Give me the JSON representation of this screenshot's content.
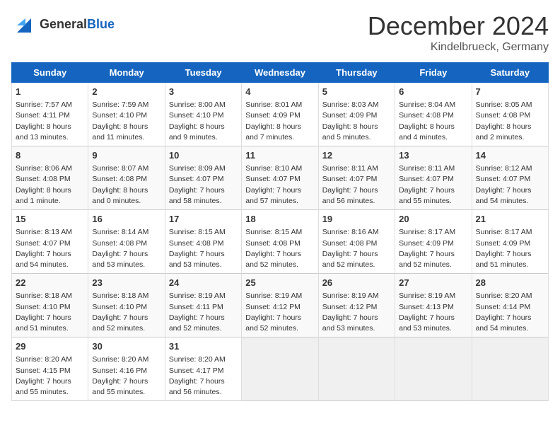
{
  "header": {
    "logo_general": "General",
    "logo_blue": "Blue",
    "title": "December 2024",
    "location": "Kindelbrueck, Germany"
  },
  "days_of_week": [
    "Sunday",
    "Monday",
    "Tuesday",
    "Wednesday",
    "Thursday",
    "Friday",
    "Saturday"
  ],
  "weeks": [
    [
      {
        "day": 1,
        "lines": [
          "Sunrise: 7:57 AM",
          "Sunset: 4:11 PM",
          "Daylight: 8 hours",
          "and 13 minutes."
        ]
      },
      {
        "day": 2,
        "lines": [
          "Sunrise: 7:59 AM",
          "Sunset: 4:10 PM",
          "Daylight: 8 hours",
          "and 11 minutes."
        ]
      },
      {
        "day": 3,
        "lines": [
          "Sunrise: 8:00 AM",
          "Sunset: 4:10 PM",
          "Daylight: 8 hours",
          "and 9 minutes."
        ]
      },
      {
        "day": 4,
        "lines": [
          "Sunrise: 8:01 AM",
          "Sunset: 4:09 PM",
          "Daylight: 8 hours",
          "and 7 minutes."
        ]
      },
      {
        "day": 5,
        "lines": [
          "Sunrise: 8:03 AM",
          "Sunset: 4:09 PM",
          "Daylight: 8 hours",
          "and 5 minutes."
        ]
      },
      {
        "day": 6,
        "lines": [
          "Sunrise: 8:04 AM",
          "Sunset: 4:08 PM",
          "Daylight: 8 hours",
          "and 4 minutes."
        ]
      },
      {
        "day": 7,
        "lines": [
          "Sunrise: 8:05 AM",
          "Sunset: 4:08 PM",
          "Daylight: 8 hours",
          "and 2 minutes."
        ]
      }
    ],
    [
      {
        "day": 8,
        "lines": [
          "Sunrise: 8:06 AM",
          "Sunset: 4:08 PM",
          "Daylight: 8 hours",
          "and 1 minute."
        ]
      },
      {
        "day": 9,
        "lines": [
          "Sunrise: 8:07 AM",
          "Sunset: 4:08 PM",
          "Daylight: 8 hours",
          "and 0 minutes."
        ]
      },
      {
        "day": 10,
        "lines": [
          "Sunrise: 8:09 AM",
          "Sunset: 4:07 PM",
          "Daylight: 7 hours",
          "and 58 minutes."
        ]
      },
      {
        "day": 11,
        "lines": [
          "Sunrise: 8:10 AM",
          "Sunset: 4:07 PM",
          "Daylight: 7 hours",
          "and 57 minutes."
        ]
      },
      {
        "day": 12,
        "lines": [
          "Sunrise: 8:11 AM",
          "Sunset: 4:07 PM",
          "Daylight: 7 hours",
          "and 56 minutes."
        ]
      },
      {
        "day": 13,
        "lines": [
          "Sunrise: 8:11 AM",
          "Sunset: 4:07 PM",
          "Daylight: 7 hours",
          "and 55 minutes."
        ]
      },
      {
        "day": 14,
        "lines": [
          "Sunrise: 8:12 AM",
          "Sunset: 4:07 PM",
          "Daylight: 7 hours",
          "and 54 minutes."
        ]
      }
    ],
    [
      {
        "day": 15,
        "lines": [
          "Sunrise: 8:13 AM",
          "Sunset: 4:07 PM",
          "Daylight: 7 hours",
          "and 54 minutes."
        ]
      },
      {
        "day": 16,
        "lines": [
          "Sunrise: 8:14 AM",
          "Sunset: 4:08 PM",
          "Daylight: 7 hours",
          "and 53 minutes."
        ]
      },
      {
        "day": 17,
        "lines": [
          "Sunrise: 8:15 AM",
          "Sunset: 4:08 PM",
          "Daylight: 7 hours",
          "and 53 minutes."
        ]
      },
      {
        "day": 18,
        "lines": [
          "Sunrise: 8:15 AM",
          "Sunset: 4:08 PM",
          "Daylight: 7 hours",
          "and 52 minutes."
        ]
      },
      {
        "day": 19,
        "lines": [
          "Sunrise: 8:16 AM",
          "Sunset: 4:08 PM",
          "Daylight: 7 hours",
          "and 52 minutes."
        ]
      },
      {
        "day": 20,
        "lines": [
          "Sunrise: 8:17 AM",
          "Sunset: 4:09 PM",
          "Daylight: 7 hours",
          "and 52 minutes."
        ]
      },
      {
        "day": 21,
        "lines": [
          "Sunrise: 8:17 AM",
          "Sunset: 4:09 PM",
          "Daylight: 7 hours",
          "and 51 minutes."
        ]
      }
    ],
    [
      {
        "day": 22,
        "lines": [
          "Sunrise: 8:18 AM",
          "Sunset: 4:10 PM",
          "Daylight: 7 hours",
          "and 51 minutes."
        ]
      },
      {
        "day": 23,
        "lines": [
          "Sunrise: 8:18 AM",
          "Sunset: 4:10 PM",
          "Daylight: 7 hours",
          "and 52 minutes."
        ]
      },
      {
        "day": 24,
        "lines": [
          "Sunrise: 8:19 AM",
          "Sunset: 4:11 PM",
          "Daylight: 7 hours",
          "and 52 minutes."
        ]
      },
      {
        "day": 25,
        "lines": [
          "Sunrise: 8:19 AM",
          "Sunset: 4:12 PM",
          "Daylight: 7 hours",
          "and 52 minutes."
        ]
      },
      {
        "day": 26,
        "lines": [
          "Sunrise: 8:19 AM",
          "Sunset: 4:12 PM",
          "Daylight: 7 hours",
          "and 53 minutes."
        ]
      },
      {
        "day": 27,
        "lines": [
          "Sunrise: 8:19 AM",
          "Sunset: 4:13 PM",
          "Daylight: 7 hours",
          "and 53 minutes."
        ]
      },
      {
        "day": 28,
        "lines": [
          "Sunrise: 8:20 AM",
          "Sunset: 4:14 PM",
          "Daylight: 7 hours",
          "and 54 minutes."
        ]
      }
    ],
    [
      {
        "day": 29,
        "lines": [
          "Sunrise: 8:20 AM",
          "Sunset: 4:15 PM",
          "Daylight: 7 hours",
          "and 55 minutes."
        ]
      },
      {
        "day": 30,
        "lines": [
          "Sunrise: 8:20 AM",
          "Sunset: 4:16 PM",
          "Daylight: 7 hours",
          "and 55 minutes."
        ]
      },
      {
        "day": 31,
        "lines": [
          "Sunrise: 8:20 AM",
          "Sunset: 4:17 PM",
          "Daylight: 7 hours",
          "and 56 minutes."
        ]
      },
      null,
      null,
      null,
      null
    ]
  ]
}
